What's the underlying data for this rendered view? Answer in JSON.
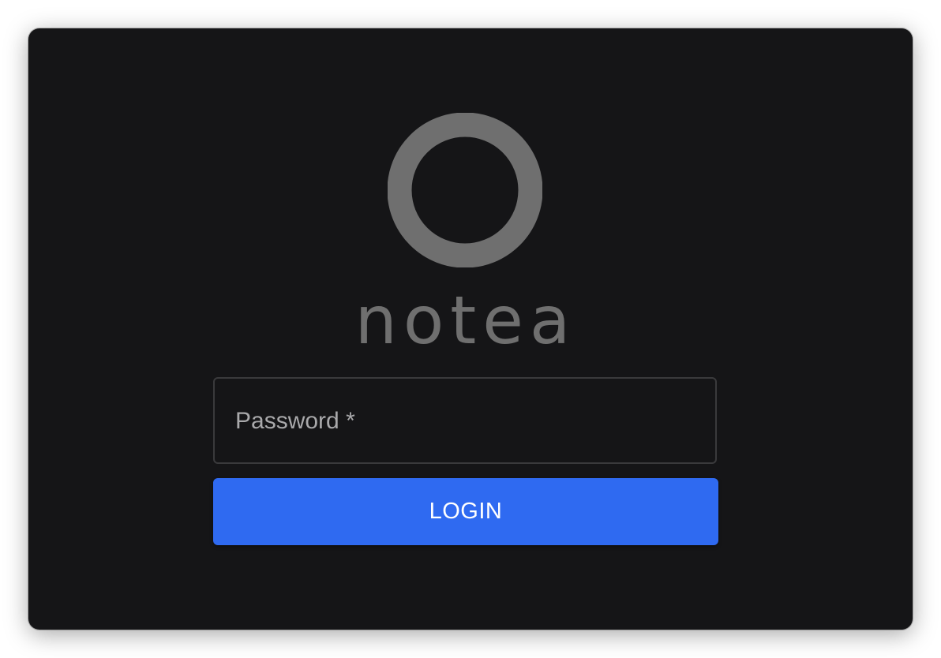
{
  "app": {
    "name": "notea"
  },
  "login_form": {
    "password_label": "Password",
    "required_marker": "*",
    "password_value": "",
    "button_label": "LOGIN"
  },
  "colors": {
    "background": "#151517",
    "logo": "#6f6f6f",
    "field_border": "#3a3a3c",
    "label": "#a9a9ab",
    "button": "#2f6af1",
    "button_text": "#ffffff"
  },
  "icons": {
    "logo": "ring-logo-icon"
  }
}
